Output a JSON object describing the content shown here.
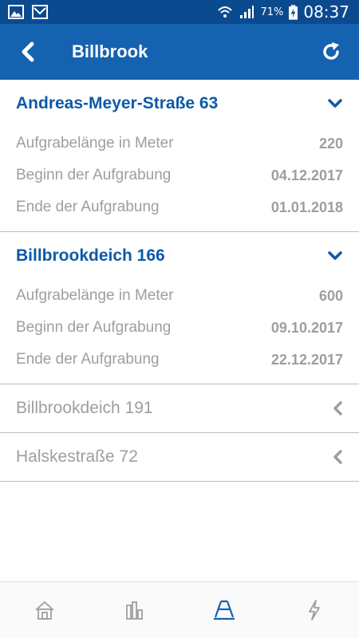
{
  "status_bar": {
    "battery_percent": "71%",
    "time": "08:37"
  },
  "app_bar": {
    "title": "Billbrook"
  },
  "sections": [
    {
      "title": "Andreas-Meyer-Straße 63",
      "expanded": true,
      "rows": [
        {
          "label": "Aufgrabelänge in Meter",
          "value": "220"
        },
        {
          "label": "Beginn der Aufgrabung",
          "value": "04.12.2017"
        },
        {
          "label": "Ende der Aufgrabung",
          "value": "01.01.2018"
        }
      ]
    },
    {
      "title": "Billbrookdeich 166",
      "expanded": true,
      "rows": [
        {
          "label": "Aufgrabelänge in Meter",
          "value": "600"
        },
        {
          "label": "Beginn der Aufgrabung",
          "value": "09.10.2017"
        },
        {
          "label": "Ende der Aufgrabung",
          "value": "22.12.2017"
        }
      ]
    },
    {
      "title": "Billbrookdeich 191",
      "expanded": false
    },
    {
      "title": "Halskestraße 72",
      "expanded": false
    }
  ],
  "bottom_nav": {
    "items": [
      "home-icon",
      "chart-icon",
      "road-icon",
      "lightning-icon"
    ],
    "active": "road-icon"
  },
  "colors": {
    "status_bar": "#0b4a8f",
    "app_bar": "#1462b0",
    "accent": "#0d5aa7",
    "muted": "#9e9e9e"
  }
}
